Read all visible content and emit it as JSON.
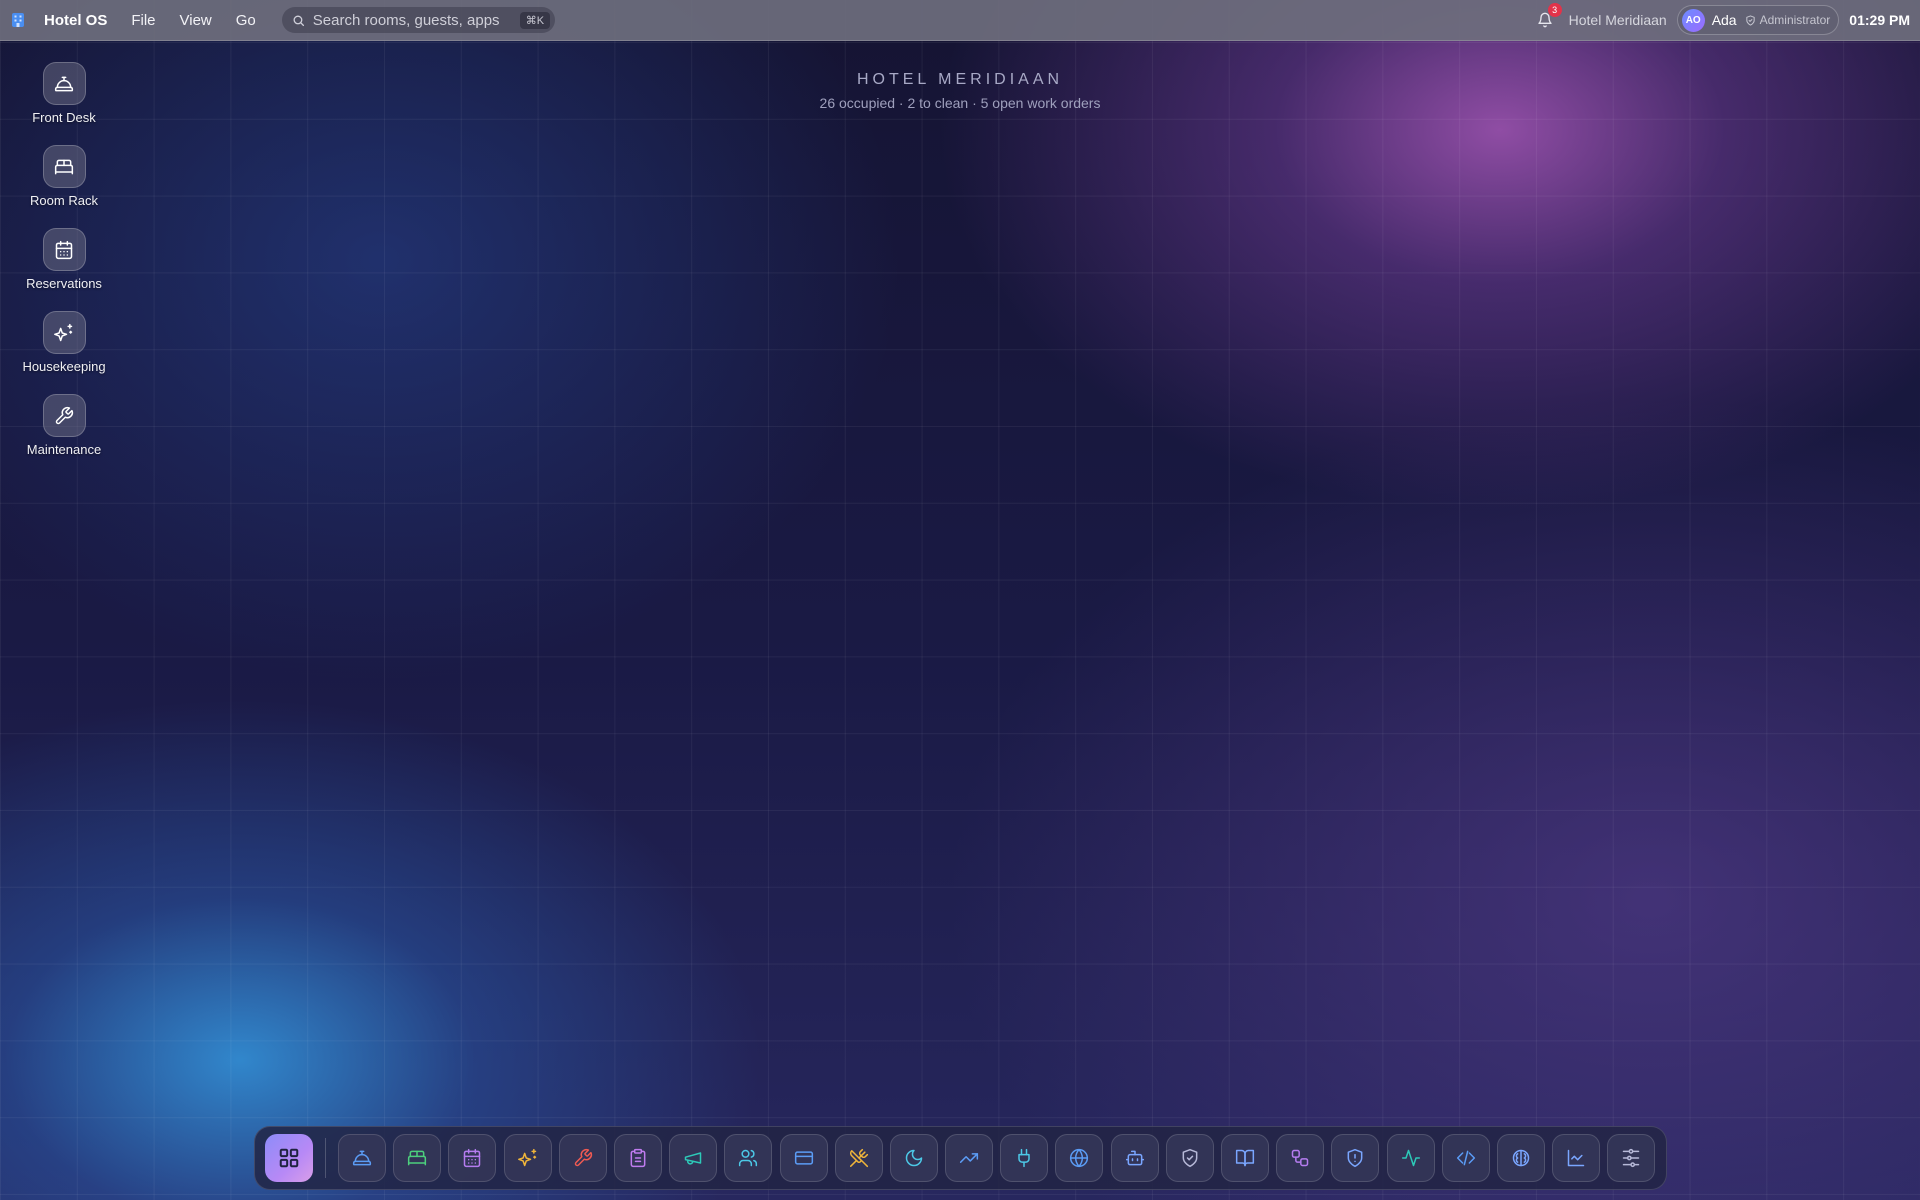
{
  "menubar": {
    "app_name": "Hotel OS",
    "menus": [
      "File",
      "View",
      "Go"
    ],
    "search": {
      "placeholder": "Search rooms, guests, apps",
      "shortcut": "⌘K"
    },
    "notifications_count": "3",
    "hotel_name": "Hotel Meridiaan",
    "user": {
      "initials": "AO",
      "name": "Ada",
      "role": "Administrator"
    },
    "clock": "01:29 PM"
  },
  "header": {
    "title": "HOTEL MERIDIAAN",
    "subtitle": "26 occupied · 2 to clean · 5 open work orders"
  },
  "desktop_icons": [
    {
      "label": "Front Desk",
      "icon": "concierge-bell-icon"
    },
    {
      "label": "Room Rack",
      "icon": "bed-icon"
    },
    {
      "label": "Reservations",
      "icon": "calendar-icon"
    },
    {
      "label": "Housekeeping",
      "icon": "sparkles-icon"
    },
    {
      "label": "Maintenance",
      "icon": "wrench-icon"
    }
  ],
  "dock": {
    "launcher_icon": "grid-icon",
    "items": [
      {
        "icon": "concierge-bell-icon",
        "color": "#5b9cf5"
      },
      {
        "icon": "bed-icon",
        "color": "#4cd07d"
      },
      {
        "icon": "calendar-icon",
        "color": "#b57cf0"
      },
      {
        "icon": "sparkles-icon",
        "color": "#f0b53a"
      },
      {
        "icon": "wrench-icon",
        "color": "#ef5a52"
      },
      {
        "icon": "clipboard-icon",
        "color": "#c07cf0"
      },
      {
        "icon": "megaphone-icon",
        "color": "#2dc9b8"
      },
      {
        "icon": "users-icon",
        "color": "#4cc8e6"
      },
      {
        "icon": "credit-card-icon",
        "color": "#5b9cf5"
      },
      {
        "icon": "utensils-icon",
        "color": "#f0b53a"
      },
      {
        "icon": "moon-icon",
        "color": "#4cc8e6"
      },
      {
        "icon": "trending-up-icon",
        "color": "#5b9cf5"
      },
      {
        "icon": "plug-icon",
        "color": "#4cc8e6"
      },
      {
        "icon": "globe-icon",
        "color": "#5b9cf5"
      },
      {
        "icon": "bot-icon",
        "color": "#7aa6ff"
      },
      {
        "icon": "shield-check-icon",
        "color": "#b7b9d8"
      },
      {
        "icon": "book-open-icon",
        "color": "#7aa6ff"
      },
      {
        "icon": "workflow-icon",
        "color": "#b57cf0"
      },
      {
        "icon": "shield-alert-icon",
        "color": "#7aa6ff"
      },
      {
        "icon": "activity-icon",
        "color": "#2dc9b8"
      },
      {
        "icon": "code-icon",
        "color": "#5b9cf5"
      },
      {
        "icon": "brain-icon",
        "color": "#7aa6ff"
      },
      {
        "icon": "line-chart-icon",
        "color": "#7aa6ff"
      },
      {
        "icon": "sliders-icon",
        "color": "#b7b9d8"
      }
    ]
  }
}
